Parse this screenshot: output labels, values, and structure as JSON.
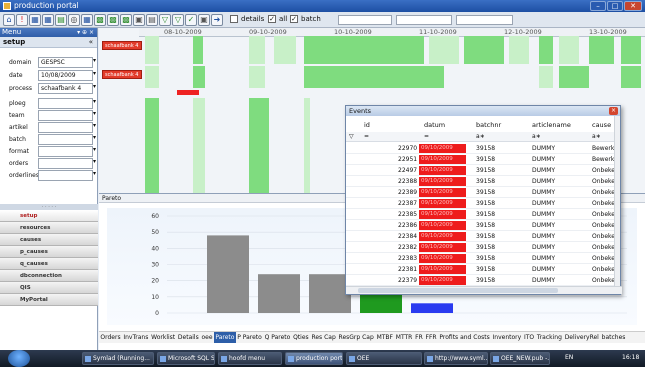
{
  "window": {
    "title": "production portal",
    "min": "–",
    "max": "□",
    "close": "✕"
  },
  "toolbar": {
    "icons": [
      "home-icon",
      "alert-icon",
      "grid-icon",
      "grid2-icon",
      "chart-icon",
      "binoculars-icon",
      "table-icon",
      "grid3-icon",
      "grid4-icon",
      "grid5-icon",
      "print-icon",
      "doc-icon",
      "filter-icon",
      "filter2-icon",
      "ok-icon",
      "print2-icon",
      "export-icon"
    ],
    "details": "details",
    "all": "all",
    "batch": "batch",
    "all_checked": "✓",
    "batch_checked": "✓"
  },
  "menu": {
    "title": "Menu",
    "controls": "▾ ⊕ ×",
    "section": "setup",
    "chevron": "«",
    "fields": [
      {
        "label": "domain",
        "value": "GESPSC"
      },
      {
        "label": "date",
        "value": "10/08/2009"
      },
      {
        "label": "process",
        "value": "schaafbank 4"
      },
      {
        "label": "ploeg",
        "value": ""
      },
      {
        "label": "team",
        "value": ""
      },
      {
        "label": "artikel",
        "value": ""
      },
      {
        "label": "batch",
        "value": ""
      },
      {
        "label": "format",
        "value": ""
      },
      {
        "label": "orders",
        "value": ""
      },
      {
        "label": "orderlines",
        "value": ""
      }
    ],
    "grip": "· · · · ·",
    "nav": [
      "setup",
      "resources",
      "causes",
      "p_causes",
      "q_causes",
      "dbconnection",
      "QIS",
      "MyPortal"
    ]
  },
  "timeline": {
    "dates": [
      "08-10-2009",
      "09-10-2009",
      "10-10-2009",
      "11-10-2009",
      "12-10-2009",
      "13-10-2009"
    ],
    "labels": [
      "schaafbank 4",
      "schaafbank 4"
    ]
  },
  "pareto": {
    "title": "Pareto"
  },
  "chart_data": {
    "type": "bar",
    "values": [
      48,
      24,
      24,
      12,
      6
    ],
    "colors": [
      "#8c8c8c",
      "#8c8c8c",
      "#8c8c8c",
      "#1f9a1f",
      "#2a3bf0"
    ],
    "yticks": [
      "0",
      "10",
      "20",
      "30",
      "40",
      "50",
      "60"
    ],
    "ylim": [
      0,
      60
    ]
  },
  "tabs": [
    "Orders",
    "InvTrans",
    "Worklist",
    "Details",
    "oee",
    "Pareto",
    "P Pareto",
    "Q Pareto",
    "Qties",
    "Res Cap",
    "ResGrp Cap",
    "MTBF",
    "MTTR",
    "FR",
    "FFR",
    "Profits and Costs",
    "Inventory",
    "ITO",
    "Tracking",
    "DeliveryRel",
    "batches"
  ],
  "active_tab": "Pareto",
  "events": {
    "title": "Events",
    "close": "×",
    "headers": [
      "id",
      "datum",
      "batchnr",
      "articlename",
      "cause"
    ],
    "filter_ops": [
      "=",
      "=",
      "a∗",
      "a∗",
      "a∗"
    ],
    "rows": [
      {
        "id": "22970",
        "datum": "09/10/2009",
        "batch": "39158",
        "article": "DUMMY",
        "cause": "Bewerk"
      },
      {
        "id": "22951",
        "datum": "09/10/2009",
        "batch": "39158",
        "article": "DUMMY",
        "cause": "Bewerk"
      },
      {
        "id": "22497",
        "datum": "09/10/2009",
        "batch": "39158",
        "article": "DUMMY",
        "cause": "Onbeke"
      },
      {
        "id": "22388",
        "datum": "09/10/2009",
        "batch": "39158",
        "article": "DUMMY",
        "cause": "Onbeke"
      },
      {
        "id": "22389",
        "datum": "09/10/2009",
        "batch": "39158",
        "article": "DUMMY",
        "cause": "Onbeke"
      },
      {
        "id": "22387",
        "datum": "09/10/2009",
        "batch": "39158",
        "article": "DUMMY",
        "cause": "Onbeke"
      },
      {
        "id": "22385",
        "datum": "09/10/2009",
        "batch": "39158",
        "article": "DUMMY",
        "cause": "Onbeke"
      },
      {
        "id": "22386",
        "datum": "09/10/2009",
        "batch": "39158",
        "article": "DUMMY",
        "cause": "Onbeke"
      },
      {
        "id": "22384",
        "datum": "09/10/2009",
        "batch": "39158",
        "article": "DUMMY",
        "cause": "Onbeke"
      },
      {
        "id": "22382",
        "datum": "09/10/2009",
        "batch": "39158",
        "article": "DUMMY",
        "cause": "Onbeke"
      },
      {
        "id": "22383",
        "datum": "09/10/2009",
        "batch": "39158",
        "article": "DUMMY",
        "cause": "Onbeke"
      },
      {
        "id": "22381",
        "datum": "09/10/2009",
        "batch": "39158",
        "article": "DUMMY",
        "cause": "Onbeke"
      },
      {
        "id": "22379",
        "datum": "09/10/2009",
        "batch": "39158",
        "article": "DUMMY",
        "cause": "Onbeke"
      }
    ]
  },
  "taskbar": {
    "items": [
      "Symlad (Running...",
      "Microsoft SQL Se...",
      "hoofd menu",
      "production portal",
      "OEE",
      "http://www.syml...",
      "OEE_NEW.pub -..."
    ],
    "active": "production portal",
    "lang": "EN",
    "clock": "16:18"
  }
}
